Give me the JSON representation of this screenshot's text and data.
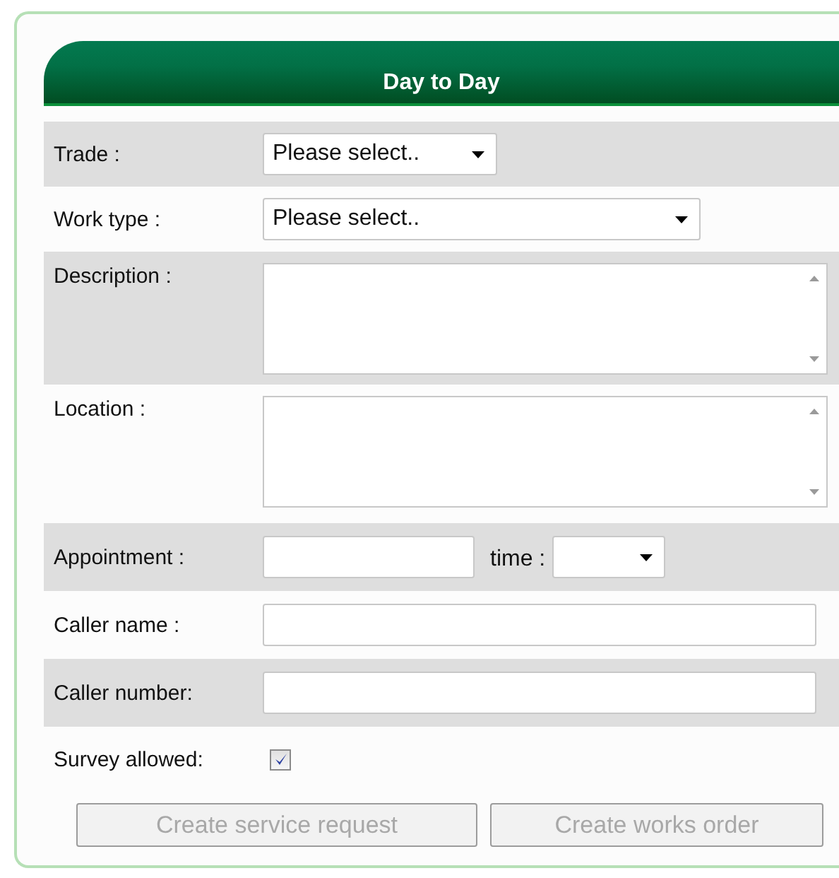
{
  "panel": {
    "title": "Day to Day"
  },
  "fields": [
    {
      "kind": "select",
      "label": "Trade :",
      "value": "Please select.."
    },
    {
      "kind": "select",
      "label": "Work type :",
      "value": "Please select.."
    },
    {
      "kind": "textarea",
      "label": "Description :"
    },
    {
      "kind": "textarea",
      "label": "Location :"
    },
    {
      "kind": "appointment",
      "label": "Appointment :",
      "time_label": "time :"
    },
    {
      "kind": "text",
      "label": "Caller name :"
    },
    {
      "kind": "text",
      "label": "Caller number:"
    },
    {
      "kind": "checkbox",
      "label": "Survey allowed:",
      "checked": true
    }
  ],
  "buttons": [
    {
      "label": "Create service request",
      "disabled": true
    },
    {
      "label": "Create works order",
      "disabled": true
    }
  ]
}
